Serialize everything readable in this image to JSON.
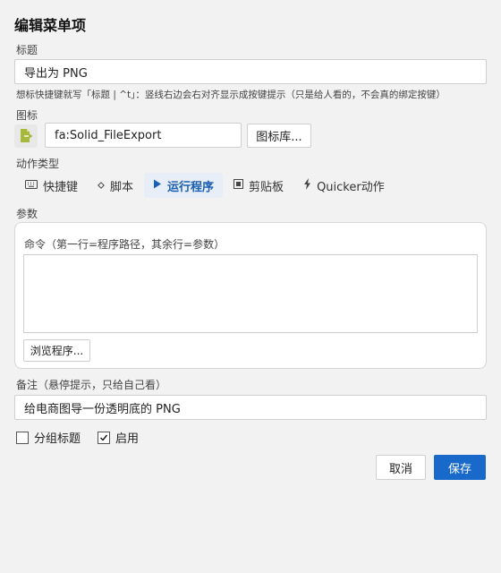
{
  "dialog": {
    "title": "编辑菜单项"
  },
  "fields": {
    "title_label": "标题",
    "title_value": "导出为 PNG",
    "title_hint": "想标快捷键就写「标题 | ^t」：竖线右边会右对齐显示成按键提示（只是给人看的，不会真的绑定按键）",
    "icon_label": "图标",
    "icon_value": "fa:Solid_FileExport",
    "icon_library_button": "图标库...",
    "action_type_label": "动作类型",
    "params_label": "参数",
    "note_label": "备注（悬停提示，只给自己看）",
    "note_value": "给电商图导一份透明底的 PNG"
  },
  "action_types": [
    {
      "label": "快捷键",
      "icon": "keyboard-icon",
      "active": false
    },
    {
      "label": "脚本",
      "icon": "diamond-icon",
      "active": false
    },
    {
      "label": "运行程序",
      "icon": "play-icon",
      "active": true
    },
    {
      "label": "剪贴板",
      "icon": "clipboard-icon",
      "active": false
    },
    {
      "label": "Quicker动作",
      "icon": "bolt-icon",
      "active": false
    }
  ],
  "params": {
    "command_label": "命令（第一行=程序路径，其余行=参数）",
    "command_value": "",
    "browse_button": "浏览程序..."
  },
  "options": {
    "group_title_label": "分组标题",
    "group_title_checked": false,
    "enable_label": "启用",
    "enable_checked": true
  },
  "footer": {
    "cancel": "取消",
    "save": "保存"
  },
  "colors": {
    "accent": "#1869c9",
    "active_tab_bg": "#e7eef7",
    "icon_green": "#a7b93a"
  }
}
